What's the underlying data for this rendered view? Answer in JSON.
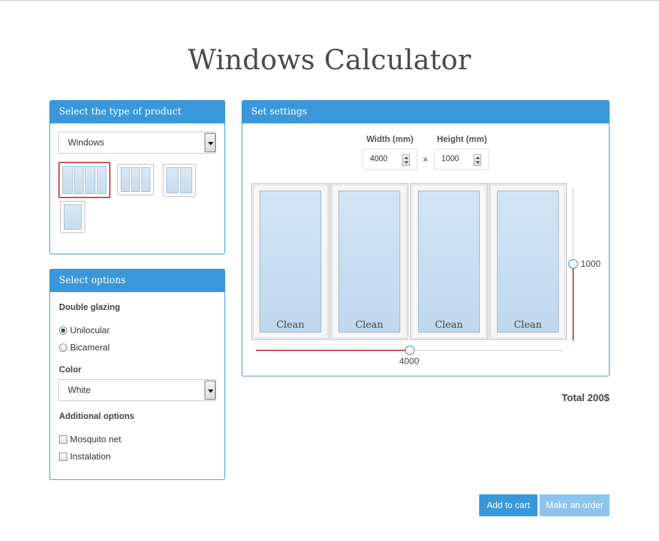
{
  "title": "Windows Calculator",
  "product_panel": {
    "header": "Select the type of product",
    "select_value": "Windows",
    "thumbnails": [
      {
        "name": "four-sash-window",
        "panes": 4,
        "selected": true
      },
      {
        "name": "three-sash-window",
        "panes": 3,
        "selected": false
      },
      {
        "name": "two-sash-window",
        "panes": 2,
        "selected": false
      },
      {
        "name": "one-sash-window",
        "panes": 1,
        "selected": false
      }
    ]
  },
  "options_panel": {
    "header": "Select options",
    "glazing_label": "Double glazing",
    "glazing_options": [
      "Unilocular",
      "Bicameral"
    ],
    "glazing_selected": "Unilocular",
    "color_label": "Color",
    "color_value": "White",
    "additional_label": "Additional options",
    "additional_options": [
      "Mosquito net",
      "Instalation"
    ]
  },
  "settings_panel": {
    "header": "Set settings",
    "width_label": "Width (mm)",
    "height_label": "Height (mm)",
    "width_value": "4000",
    "height_value": "1000",
    "times": "×",
    "sashes": [
      "Clean",
      "Clean",
      "Clean",
      "Clean"
    ],
    "width_slider": {
      "value": "4000",
      "fraction": 0.5
    },
    "height_slider": {
      "value": "1000",
      "fraction": 0.5
    }
  },
  "total": "Total 200$",
  "buttons": {
    "add_to_cart": "Add to cart",
    "make_order": "Make an order"
  },
  "colors": {
    "accent": "#3a97d9",
    "accent_light": "#8dc4ec",
    "selection_red": "#c0504d"
  }
}
